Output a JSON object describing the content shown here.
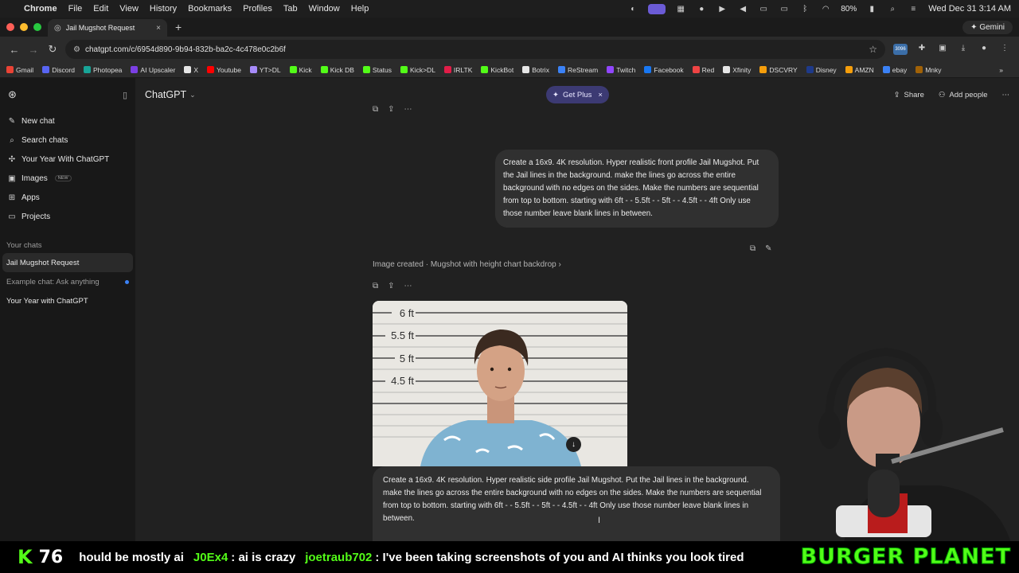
{
  "menubar": {
    "app_name": "Chrome",
    "menus": [
      "File",
      "Edit",
      "View",
      "History",
      "Bookmarks",
      "Profiles",
      "Tab",
      "Window",
      "Help"
    ],
    "battery": "80%",
    "datetime": "Wed Dec 31  3:14 AM"
  },
  "browser": {
    "tab_title": "Jail Mugshot Request",
    "gemini_label": "Gemini",
    "url": "chatgpt.com/c/6954d890-9b94-832b-ba2c-4c478e0c2b6f",
    "bookmarks": [
      {
        "label": "Gmail",
        "color": "#ea4335"
      },
      {
        "label": "Discord",
        "color": "#5865f2"
      },
      {
        "label": "Photopea",
        "color": "#18a497"
      },
      {
        "label": "AI Upscaler",
        "color": "#7b3fe4"
      },
      {
        "label": "X",
        "color": "#e6e6e6"
      },
      {
        "label": "Youtube",
        "color": "#ff0000"
      },
      {
        "label": "YT>DL",
        "color": "#a78bfa"
      },
      {
        "label": "Kick",
        "color": "#53fc18"
      },
      {
        "label": "Kick DB",
        "color": "#53fc18"
      },
      {
        "label": "Status",
        "color": "#53fc18"
      },
      {
        "label": "Kick>DL",
        "color": "#53fc18"
      },
      {
        "label": "IRLTK",
        "color": "#e11d48"
      },
      {
        "label": "KickBot",
        "color": "#53fc18"
      },
      {
        "label": "Botrix",
        "color": "#e6e6e6"
      },
      {
        "label": "ReStream",
        "color": "#3b82f6"
      },
      {
        "label": "Twitch",
        "color": "#9146ff"
      },
      {
        "label": "Facebook",
        "color": "#1877f2"
      },
      {
        "label": "Red",
        "color": "#ef4444"
      },
      {
        "label": "Xfinity",
        "color": "#e6e6e6"
      },
      {
        "label": "DSCVRY",
        "color": "#f59e0b"
      },
      {
        "label": "Disney",
        "color": "#1e3a8a"
      },
      {
        "label": "AMZN",
        "color": "#f59e0b"
      },
      {
        "label": "ebay",
        "color": "#3b82f6"
      },
      {
        "label": "Mnky",
        "color": "#a16207"
      }
    ]
  },
  "sidebar": {
    "items": [
      {
        "label": "New chat",
        "icon": "✎"
      },
      {
        "label": "Search chats",
        "icon": "⌕"
      },
      {
        "label": "Your Year With ChatGPT",
        "icon": "✣"
      },
      {
        "label": "Images",
        "icon": "▣",
        "badge": "NEW"
      },
      {
        "label": "Apps",
        "icon": "⊞"
      },
      {
        "label": "Projects",
        "icon": "▭"
      }
    ],
    "section_title": "Your chats",
    "chats": [
      "Jail Mugshot Request",
      "Example chat: Ask anything",
      "Your Year with ChatGPT"
    ]
  },
  "header": {
    "model": "ChatGPT",
    "get_plus": "Get Plus",
    "share": "Share",
    "add_people": "Add people"
  },
  "conversation": {
    "user_prompt_1": "Create a 16x9. 4K resolution. Hyper realistic front profile Jail Mugshot. Put the Jail lines in the background. make the lines go across the entire background with no edges on the sides. Make the numbers are sequential from top to bottom. starting with 6ft - - 5.5ft - - 5ft - - 4.5ft - - 4ft  Only use those number leave blank lines in between.",
    "image_created": "Image created",
    "image_title": "Mugshot with height chart backdrop",
    "height_labels": [
      "6 ft",
      "5.5 ft",
      "5 ft",
      "4.5 ft"
    ]
  },
  "composer": {
    "value": "Create a 16x9. 4K resolution. Hyper realistic side profile Jail Mugshot. Put the Jail lines in the background. make the lines go across the entire background with no edges on the sides. Make the numbers are sequential from top to bottom. starting with 6ft - - 5.5ft - - 5ft - - 4.5ft - - 4ft Only use those number leave blank lines in between."
  },
  "stream": {
    "viewer_count": "76",
    "ticker_pre": "hould be mostly ai",
    "user1": "J0Ex4",
    "msg1": ": ai is crazy",
    "user2": "joetraub702",
    "msg2": ": I've been taking screenshots of you and AI thinks you look tired",
    "brand": "BURGER PLANET"
  }
}
